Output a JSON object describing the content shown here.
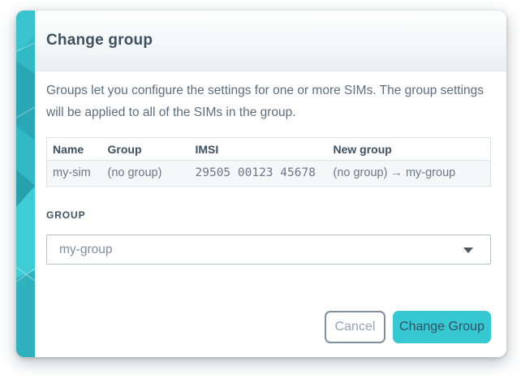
{
  "modal": {
    "title": "Change group",
    "description": "Groups let you configure the settings for one or more SIMs. The group settings will be applied to all of the SIMs in the group.",
    "table": {
      "columns": [
        "Name",
        "Group",
        "IMSI",
        "New group"
      ],
      "rows": [
        [
          "my-sim",
          "(no group)",
          "29505 00123 45678",
          "(no group) → my-group"
        ]
      ]
    },
    "group_field": {
      "label": "GROUP",
      "value": "my-group"
    },
    "buttons": {
      "cancel": "Cancel",
      "submit": "Change Group"
    }
  },
  "icons": {
    "chevron_down": "caret-down-triangle"
  },
  "colors": {
    "accent": "#36c9d4",
    "teal_background": "#31b9c5",
    "teal_dark": "#279fac",
    "teal_light": "#3ecdd6",
    "title_text": "#3e5161",
    "body_text": "#5d6e7e",
    "muted_text": "#7e8d9e"
  }
}
